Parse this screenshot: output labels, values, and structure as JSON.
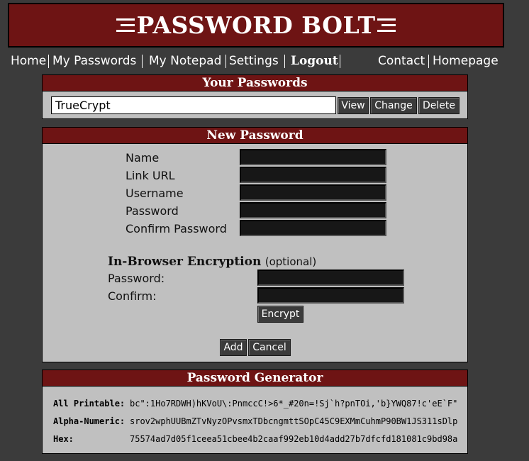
{
  "app": {
    "title": "PASSWORD BOLT"
  },
  "nav": {
    "home": "Home",
    "my_passwords": "My Passwords",
    "my_notepad": "My Notepad",
    "settings": "Settings",
    "logout": "Logout",
    "contact": "Contact",
    "homepage": "Homepage"
  },
  "your_passwords": {
    "title": "Your Passwords",
    "selected": "TrueCrypt",
    "view_label": "View",
    "change_label": "Change",
    "delete_label": "Delete"
  },
  "new_password": {
    "title": "New Password",
    "name_label": "Name",
    "link_label": "Link URL",
    "username_label": "Username",
    "password_label": "Password",
    "confirm_label": "Confirm Password",
    "name_value": "",
    "link_value": "",
    "username_value": "",
    "password_value": "",
    "confirm_value": "",
    "encryption_heading": "In-Browser Encryption",
    "encryption_optional": "(optional)",
    "enc_password_label": "Password:",
    "enc_confirm_label": "Confirm:",
    "enc_password_value": "",
    "enc_confirm_value": "",
    "encrypt_label": "Encrypt",
    "add_label": "Add",
    "cancel_label": "Cancel"
  },
  "generator": {
    "title": "Password Generator",
    "rows": [
      {
        "label": "All Printable:",
        "value": "bc\":1Ho7RDWH)hKVoU\\:PnmccC!>6*_#20n=!Sj`h?pnTOi,'b}YWQ87!c'eE`F\""
      },
      {
        "label": "Alpha-Numeric:",
        "value": "srov2wphUUBmZTvNyzOPvsmxTDbcngmttSOpC45C9EXMmCuhmP90BW1JS311sDlp"
      },
      {
        "label": "Hex:",
        "value": "75574ad7d05f1ceea51cbee4b2caaf992eb10d4add27b7dfcfd181081c9bd98a"
      }
    ]
  }
}
